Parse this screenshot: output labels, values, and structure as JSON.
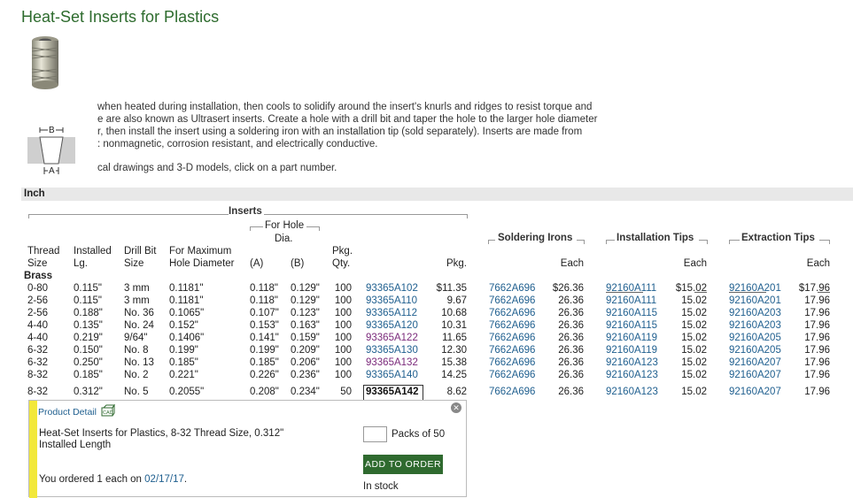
{
  "page": {
    "title": "Heat-Set Inserts for Plastics",
    "description_lines": [
      "when heated during installation, then cools to solidify around the insert's knurls and ridges to resist torque and",
      "e are also known as Ultrasert inserts. Create a hole with a drill bit and taper the hole to the larger hole diameter",
      "r, then install the insert using a soldering iron with an installation tip (sold separately). Inserts are made from",
      ": nonmagnetic, corrosion resistant, and electrically conductive.",
      "cal drawings and 3-D models, click on a part number."
    ],
    "diagram_labels": {
      "top": "B",
      "bottom": "A"
    }
  },
  "section": {
    "label": "Inch"
  },
  "table": {
    "group_headers": {
      "inserts": "Inserts",
      "for_hole_dia": "For Hole",
      "for_hole_dia2": "Dia.",
      "soldering_irons": "Soldering Irons",
      "installation_tips": "Installation Tips",
      "extraction_tips": "Extraction Tips"
    },
    "headers": {
      "thread_size_1": "Thread",
      "thread_size_2": "Size",
      "installed_lg_1": "Installed",
      "installed_lg_2": "Lg.",
      "drill_bit_1": "Drill Bit",
      "drill_bit_2": "Size",
      "max_hole_1": "For Maximum",
      "max_hole_2": "Hole Diameter",
      "a": "(A)",
      "b": "(B)",
      "pkg_qty_1": "Pkg.",
      "pkg_qty_2": "Qty.",
      "pkg": "Pkg.",
      "each_iron": "Each",
      "each_install": "Each",
      "each_extract": "Each"
    },
    "subgroup": "Brass",
    "rows": [
      {
        "thread": "0-80",
        "lg": "0.115\"",
        "drill": "3 mm",
        "maxhole": "0.1181\"",
        "a": "0.118\"",
        "b": "0.129\"",
        "qty": "100",
        "part": "93365A102",
        "pkg": "$11.35",
        "iron": "7662A696",
        "iron_each": "$26.36",
        "inst": "92160A111",
        "inst_each": "$15.02",
        "ext": "92160A201",
        "ext_each": "$17.96",
        "visited": false
      },
      {
        "thread": "2-56",
        "lg": "0.115\"",
        "drill": "3 mm",
        "maxhole": "0.1181\"",
        "a": "0.118\"",
        "b": "0.129\"",
        "qty": "100",
        "part": "93365A110",
        "pkg": "9.67",
        "iron": "7662A696",
        "iron_each": "26.36",
        "inst": "92160A111",
        "inst_each": "15.02",
        "ext": "92160A201",
        "ext_each": "17.96",
        "visited": false
      },
      {
        "thread": "2-56",
        "lg": "0.188\"",
        "drill": "No. 36",
        "maxhole": "0.1065\"",
        "a": "0.107\"",
        "b": "0.123\"",
        "qty": "100",
        "part": "93365A112",
        "pkg": "10.68",
        "iron": "7662A696",
        "iron_each": "26.36",
        "inst": "92160A115",
        "inst_each": "15.02",
        "ext": "92160A203",
        "ext_each": "17.96",
        "visited": false
      },
      {
        "thread": "4-40",
        "lg": "0.135\"",
        "drill": "No. 24",
        "maxhole": "0.152\"",
        "a": "0.153\"",
        "b": "0.163\"",
        "qty": "100",
        "part": "93365A120",
        "pkg": "10.31",
        "iron": "7662A696",
        "iron_each": "26.36",
        "inst": "92160A115",
        "inst_each": "15.02",
        "ext": "92160A203",
        "ext_each": "17.96",
        "visited": false
      },
      {
        "thread": "4-40",
        "lg": "0.219\"",
        "drill": "9/64\"",
        "maxhole": "0.1406\"",
        "a": "0.141\"",
        "b": "0.159\"",
        "qty": "100",
        "part": "93365A122",
        "pkg": "11.65",
        "iron": "7662A696",
        "iron_each": "26.36",
        "inst": "92160A119",
        "inst_each": "15.02",
        "ext": "92160A205",
        "ext_each": "17.96",
        "visited": true
      },
      {
        "thread": "6-32",
        "lg": "0.150\"",
        "drill": "No. 8",
        "maxhole": "0.199\"",
        "a": "0.199\"",
        "b": "0.209\"",
        "qty": "100",
        "part": "93365A130",
        "pkg": "12.30",
        "iron": "7662A696",
        "iron_each": "26.36",
        "inst": "92160A119",
        "inst_each": "15.02",
        "ext": "92160A205",
        "ext_each": "17.96",
        "visited": false
      },
      {
        "thread": "6-32",
        "lg": "0.250\"",
        "drill": "No. 13",
        "maxhole": "0.185\"",
        "a": "0.185\"",
        "b": "0.206\"",
        "qty": "100",
        "part": "93365A132",
        "pkg": "15.38",
        "iron": "7662A696",
        "iron_each": "26.36",
        "inst": "92160A123",
        "inst_each": "15.02",
        "ext": "92160A207",
        "ext_each": "17.96",
        "visited": true
      },
      {
        "thread": "8-32",
        "lg": "0.185\"",
        "drill": "No. 2",
        "maxhole": "0.221\"",
        "a": "0.226\"",
        "b": "0.236\"",
        "qty": "100",
        "part": "93365A140",
        "pkg": "14.25",
        "iron": "7662A696",
        "iron_each": "26.36",
        "inst": "92160A123",
        "inst_each": "15.02",
        "ext": "92160A207",
        "ext_each": "17.96",
        "visited": false
      },
      {
        "thread": "8-32",
        "lg": "0.312\"",
        "drill": "No. 5",
        "maxhole": "0.2055\"",
        "a": "0.208\"",
        "b": "0.234\"",
        "qty": "50",
        "part": "93365A142",
        "pkg": "8.62",
        "iron": "7662A696",
        "iron_each": "26.36",
        "inst": "92160A123",
        "inst_each": "15.02",
        "ext": "92160A207",
        "ext_each": "17.96",
        "visited": false,
        "selected": true
      }
    ]
  },
  "detail": {
    "link_label": "Product Detail",
    "cad_label": "CAD",
    "description": "Heat-Set Inserts for Plastics, 8-32 Thread Size, 0.312\"",
    "description2": "Installed Length",
    "ordered_prefix": "You ordered 1 each on ",
    "ordered_date": "02/17/17",
    "ordered_suffix": ".",
    "qty_value": "",
    "packs_label": "Packs of 50",
    "add_button": "ADD TO ORDER",
    "stock": "In stock"
  },
  "colors": {
    "title": "#2d6b2d",
    "link": "#1f5f8f",
    "visited": "#7b2a7b",
    "button": "#2f6a2f",
    "accent_bar": "#f2e83a"
  }
}
